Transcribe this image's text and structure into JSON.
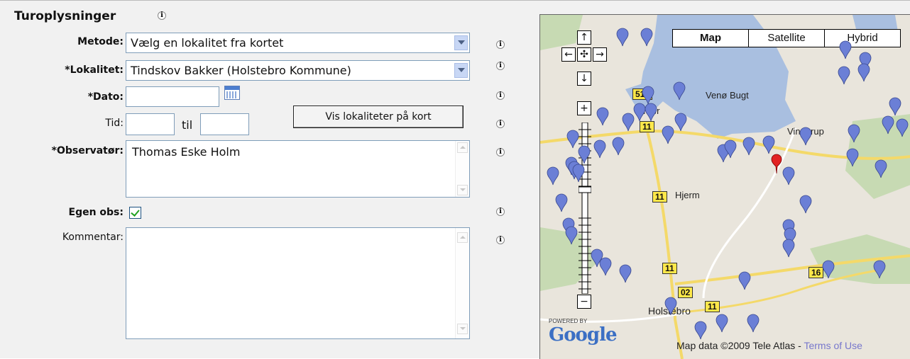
{
  "section": {
    "title": "Turoplysninger"
  },
  "form": {
    "metode": {
      "label": "Metode:",
      "value": "Vælg en lokalitet fra kortet"
    },
    "lokalitet": {
      "label": "*Lokalitet:",
      "value": "Tindskov Bakker (Holstebro Kommune)"
    },
    "dato": {
      "label": "*Dato:",
      "value": ""
    },
    "tid": {
      "label": "Tid:",
      "from": "",
      "til_label": "til",
      "to": ""
    },
    "vis_button": "Vis lokaliteter på kort",
    "observator": {
      "label": "*Observatør:",
      "value": "Thomas Eske Holm"
    },
    "egen_obs": {
      "label": "Egen obs:",
      "checked": true
    },
    "kommentar": {
      "label": "Kommentar:",
      "value": ""
    }
  },
  "map": {
    "types": [
      "Map",
      "Satellite",
      "Hybrid"
    ],
    "selected_type": "Map",
    "nav": {
      "up": "↑",
      "left": "←",
      "center": "✣",
      "right": "→",
      "down": "↓",
      "zoom_in": "+",
      "zoom_out": "−"
    },
    "labels": {
      "bay": "Venø Bugt",
      "town1": "Vinderup",
      "town2": "Hjerm",
      "town3": "Holstebro",
      "town4": "Struer"
    },
    "road_shields": [
      "513",
      "11",
      "11",
      "11",
      "02",
      "16",
      "11"
    ],
    "powered_by": "POWERED BY",
    "google_logo": "Google",
    "copyright": "Map data ©2009 Tele Atlas - ",
    "terms_link": "Terms of Use",
    "colors": {
      "water": "#a9bfe0",
      "land": "#e9e5dc",
      "green": "#c7dab3",
      "road": "#f4d969",
      "marker_blue": "#6b7fd6",
      "marker_red": "#e22222"
    }
  }
}
